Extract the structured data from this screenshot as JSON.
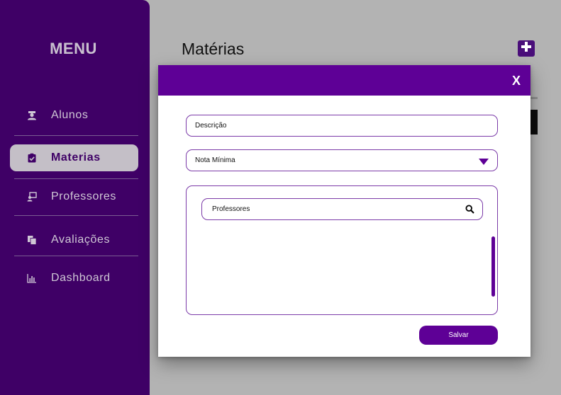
{
  "sidebar": {
    "title": "MENU",
    "items": [
      {
        "label": "Alunos",
        "icon": "student-icon",
        "active": false
      },
      {
        "label": "Materias",
        "icon": "clipboard-check-icon",
        "active": true
      },
      {
        "label": "Professores",
        "icon": "teacher-icon",
        "active": false
      },
      {
        "label": "Avaliações",
        "icon": "documents-icon",
        "active": false
      },
      {
        "label": "Dashboard",
        "icon": "bar-chart-icon",
        "active": false
      }
    ]
  },
  "main": {
    "title": "Matérias",
    "add_button_icon": "plus-icon"
  },
  "modal": {
    "close_label": "X",
    "description_placeholder": "Descrição",
    "min_grade_label": "Nota Mínima",
    "professors_search_placeholder": "Professores",
    "save_label": "Salvar"
  },
  "colors": {
    "sidebar_bg": "#3f0066",
    "accent": "#5e0096",
    "active_item_bg": "#c4bfc7",
    "overlay_bg": "#b3b3b3"
  }
}
